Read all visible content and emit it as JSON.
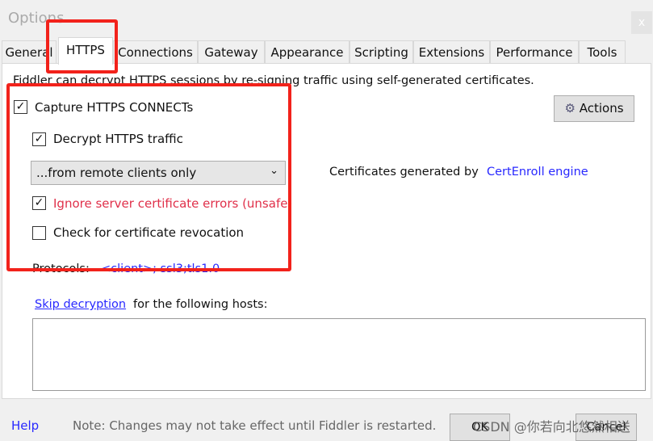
{
  "window": {
    "title": "Options",
    "close": "x"
  },
  "tabs": [
    {
      "label": "General"
    },
    {
      "label": "HTTPS",
      "selected": true
    },
    {
      "label": "Connections"
    },
    {
      "label": "Gateway"
    },
    {
      "label": "Appearance"
    },
    {
      "label": "Scripting"
    },
    {
      "label": "Extensions"
    },
    {
      "label": "Performance"
    },
    {
      "label": "Tools"
    }
  ],
  "https": {
    "description": "Fiddler can decrypt HTTPS sessions by re-signing traffic using self-generated certificates.",
    "capture": {
      "label": "Capture HTTPS CONNECTs",
      "checked": true
    },
    "decrypt": {
      "label": "Decrypt HTTPS traffic",
      "checked": true
    },
    "source_select": {
      "value": "...from remote clients only"
    },
    "ignore_errors": {
      "label": "Ignore server certificate errors (unsafe)",
      "checked": true,
      "color": "#e0304a"
    },
    "revocation": {
      "label": "Check for certificate revocation",
      "checked": false
    },
    "protocols_label": "Protocols:",
    "protocols_value": "<client>; ssl3;tls1.0",
    "actions_label": "Actions",
    "cert_text": "Certificates generated by",
    "cert_link": "CertEnroll engine",
    "skip_link": "Skip decryption",
    "skip_text": "for the following hosts:",
    "skip_hosts": ""
  },
  "footer": {
    "help": "Help",
    "note": "Note: Changes may not take effect until Fiddler is restarted.",
    "ok": "OK",
    "cancel": "Cancel"
  },
  "watermark": "CSDN @你若向北悠然相送",
  "colors": {
    "highlight": "#f2221b",
    "link": "#2828ff"
  }
}
